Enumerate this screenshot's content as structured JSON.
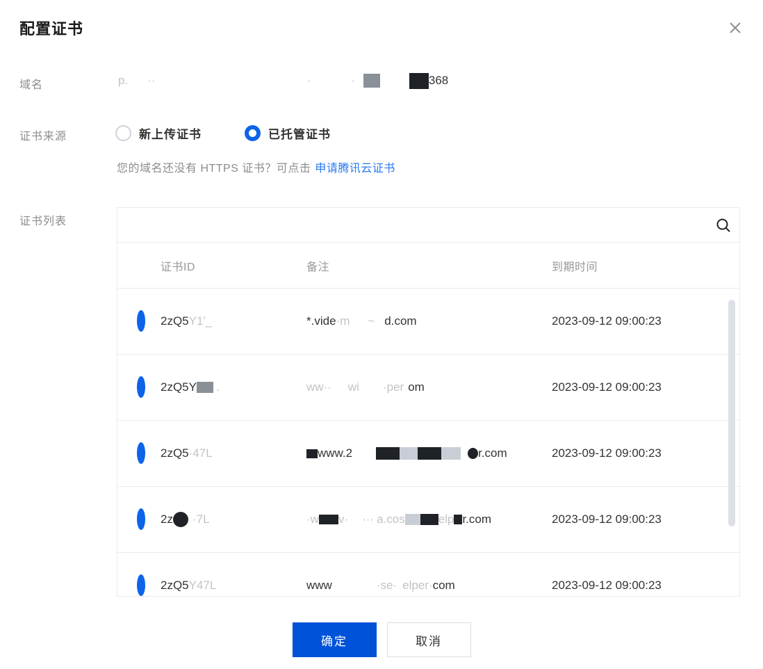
{
  "dialog": {
    "title": "配置证书",
    "close_icon": "close-x"
  },
  "form": {
    "domain_label": "域名",
    "source_label": "证书来源",
    "list_label": "证书列表",
    "source_options": [
      {
        "label": "新上传证书",
        "selected": false
      },
      {
        "label": "已托管证书",
        "selected": true
      }
    ],
    "hint_text": "您的域名还没有 HTTPS 证书？可点击",
    "hint_link": "申请腾讯云证书"
  },
  "domain_value_segments": [
    {
      "t": "p.",
      "s": "g"
    },
    {
      "sp": 28
    },
    {
      "t": "··",
      "s": "g"
    },
    {
      "sp": 218
    },
    {
      "t": "·",
      "s": "g"
    },
    {
      "sp": 58
    },
    {
      "t": "·",
      "s": "g"
    },
    {
      "sp": 12
    },
    {
      "b": "bg",
      "w": 24,
      "h": 20
    },
    {
      "sp": 42
    },
    {
      "b": "bd",
      "w": 28,
      "h": 23
    },
    {
      "t": "368",
      "s": "n"
    }
  ],
  "cert_table": {
    "search_value": "",
    "search_icon": "magnifier",
    "columns": [
      "证书ID",
      "备注",
      "到期时间"
    ],
    "rows": [
      {
        "selected": true,
        "id_segments": [
          {
            "t": "2zQ5",
            "s": "n"
          },
          {
            "t": "Y1'_",
            "s": "g"
          }
        ],
        "remark_segments": [
          {
            "t": "*.vide",
            "s": "n"
          },
          {
            "t": "·m",
            "s": "g"
          },
          {
            "sp": 26
          },
          {
            "t": "~",
            "s": "g"
          },
          {
            "sp": 14
          },
          {
            "t": "d.com",
            "s": "n"
          }
        ],
        "expire": "2023-09-12 09:00:23"
      },
      {
        "selected": true,
        "id_segments": [
          {
            "t": "2zQ5Y",
            "s": "n"
          },
          {
            "b": "bg",
            "w": 24,
            "h": 16
          },
          {
            "t": " .",
            "s": "g"
          }
        ],
        "remark_segments": [
          {
            "t": "ww··",
            "s": "g"
          },
          {
            "sp": 24
          },
          {
            "t": "wi",
            "s": "g"
          },
          {
            "sp": 34
          },
          {
            "t": "·per",
            "s": "g"
          },
          {
            "sp": 6
          },
          {
            "t": "om",
            "s": "n"
          }
        ],
        "expire": "2023-09-12 09:00:23"
      },
      {
        "selected": true,
        "id_segments": [
          {
            "t": "2zQ5",
            "s": "n"
          },
          {
            "t": "·47L",
            "s": "g"
          }
        ],
        "remark_segments": [
          {
            "b": "bd",
            "w": 16,
            "h": 13
          },
          {
            "t": "www.2",
            "s": "n"
          },
          {
            "sp": 34
          },
          {
            "b": "bd",
            "w": 34,
            "h": 18
          },
          {
            "b": "bl",
            "w": 26,
            "h": 18
          },
          {
            "b": "bd",
            "w": 34,
            "h": 18
          },
          {
            "b": "bl",
            "w": 28,
            "h": 18
          },
          {
            "sp": 10
          },
          {
            "b": "bd",
            "w": 15,
            "h": 16,
            "r": 1
          },
          {
            "t": "r.com",
            "s": "n"
          }
        ],
        "expire": "2023-09-12 09:00:23"
      },
      {
        "selected": true,
        "id_segments": [
          {
            "t": "2z",
            "s": "n"
          },
          {
            "b": "bd",
            "w": 22,
            "h": 22,
            "r": 1
          },
          {
            "sp": 6
          },
          {
            "t": "·7L",
            "s": "g"
          }
        ],
        "remark_segments": [
          {
            "t": "·w",
            "s": "g"
          },
          {
            "b": "bd",
            "w": 28,
            "h": 14
          },
          {
            "t": "v·",
            "s": "g"
          },
          {
            "sp": 20
          },
          {
            "t": "···",
            "s": "g"
          },
          {
            "sp": 4
          },
          {
            "t": "a.cos",
            "s": "g"
          },
          {
            "b": "bl",
            "w": 22,
            "h": 16
          },
          {
            "b": "bd",
            "w": 26,
            "h": 16
          },
          {
            "t": "elp",
            "s": "g"
          },
          {
            "b": "bd",
            "w": 12,
            "h": 14
          },
          {
            "t": "r.com",
            "s": "n"
          }
        ],
        "expire": "2023-09-12 09:00:23"
      },
      {
        "selected": true,
        "id_segments": [
          {
            "t": "2zQ5",
            "s": "n"
          },
          {
            "t": "Y47L",
            "s": "g"
          }
        ],
        "remark_segments": [
          {
            "t": "www",
            "s": "n"
          },
          {
            "sp": 64
          },
          {
            "t": "·se·",
            "s": "g"
          },
          {
            "sp": 8
          },
          {
            "t": "elper·",
            "s": "g"
          },
          {
            "t": "com",
            "s": "n"
          }
        ],
        "expire": "2023-09-12 09:00:23"
      }
    ]
  },
  "footer": {
    "confirm_label": "确定",
    "cancel_label": "取消"
  },
  "colors": {
    "button_blue": "#0052d9",
    "radio_blue": "#0d64e8",
    "link_blue": "#2878f0",
    "label_gray": "#8c8c8c",
    "border_gray": "#e8ebf0",
    "scroll_thumb": "#dde0e6",
    "redact_dark": "#1f2226",
    "redact_gray": "#8a9097"
  }
}
